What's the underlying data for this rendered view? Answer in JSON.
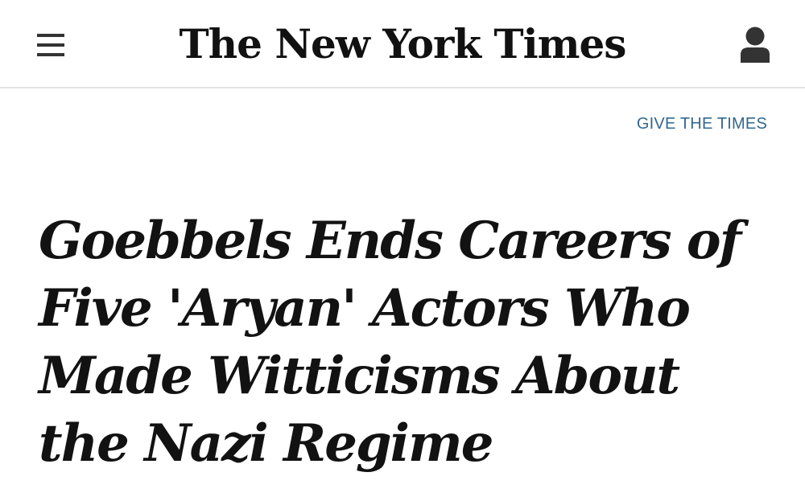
{
  "header": {
    "logo_text": "The New York Times",
    "menu_icon": "hamburger-menu-icon",
    "account_icon": "user-account-icon"
  },
  "promo": {
    "give_link": "GIVE THE TIMES"
  },
  "article": {
    "headline": "Goebbels Ends Careers of Five 'Aryan' Actors Who Made Witticisms About the Nazi Regime"
  },
  "colors": {
    "link": "#326891",
    "text": "#121212",
    "icon": "#333333",
    "divider": "#e2e2e2"
  }
}
